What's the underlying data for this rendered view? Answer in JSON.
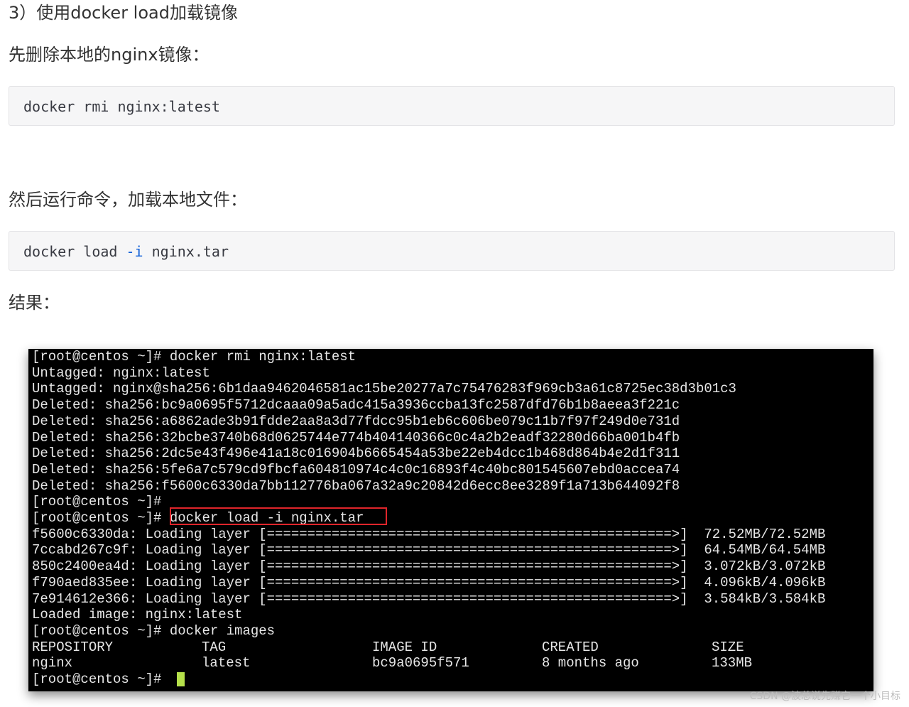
{
  "step_heading": "3）使用docker load加载镜像",
  "remove_heading": "先删除本地的nginx镜像：",
  "remove_command": "docker rmi nginx:latest",
  "load_heading": "然后运行命令，加载本地文件：",
  "load_command": {
    "before": "docker load ",
    "flag": "-i",
    "after": " nginx.tar"
  },
  "result_heading": "结果：",
  "terminal": {
    "lines": [
      "[root@centos ~]# docker rmi nginx:latest",
      "Untagged: nginx:latest",
      "Untagged: nginx@sha256:6b1daa9462046581ac15be20277a7c75476283f969cb3a61c8725ec38d3b01c3",
      "Deleted: sha256:bc9a0695f5712dcaaa09a5adc415a3936ccba13fc2587dfd76b1b8aeea3f221c",
      "Deleted: sha256:a6862ade3b91fdde2aa8a3d77fdcc95b1eb6c606be079c11b7f97f249d0e731d",
      "Deleted: sha256:32bcbe3740b68d0625744e774b404140366c0c4a2b2eadf32280d66ba001b4fb",
      "Deleted: sha256:2dc5e43f496e41a18c016904b6665454a53be22eb4dcc1b468d864b4e2d1f311",
      "Deleted: sha256:5fe6a7c579cd9fbcfa604810974c4c0c16893f4c40bc801545607ebd0accea74",
      "Deleted: sha256:f5600c6330da7bb112776ba067a32a9c20842d6ecc8ee3289f1a713b644092f8",
      "[root@centos ~]#",
      "[root@centos ~]# docker load -i nginx.tar",
      "f5600c6330da: Loading layer [==================================================>]  72.52MB/72.52MB",
      "7ccabd267c9f: Loading layer [==================================================>]  64.54MB/64.54MB",
      "850c2400ea4d: Loading layer [==================================================>]  3.072kB/3.072kB",
      "f790aed835ee: Loading layer [==================================================>]  4.096kB/4.096kB",
      "7e914612e366: Loading layer [==================================================>]  3.584kB/3.584kB",
      "Loaded image: nginx:latest",
      "[root@centos ~]# docker images"
    ],
    "table_headers": [
      "REPOSITORY",
      "TAG",
      "IMAGE ID",
      "CREATED",
      "SIZE"
    ],
    "table_rows": [
      [
        "nginx",
        "latest",
        "bc9a0695f571",
        "8 months ago",
        "133MB"
      ]
    ],
    "final_prompt": "[root@centos ~]# ",
    "highlight_color": "#e0252b",
    "cursor_color": "#b5e04a"
  },
  "watermark": "CSDN @波总说先赚它一个小目标"
}
